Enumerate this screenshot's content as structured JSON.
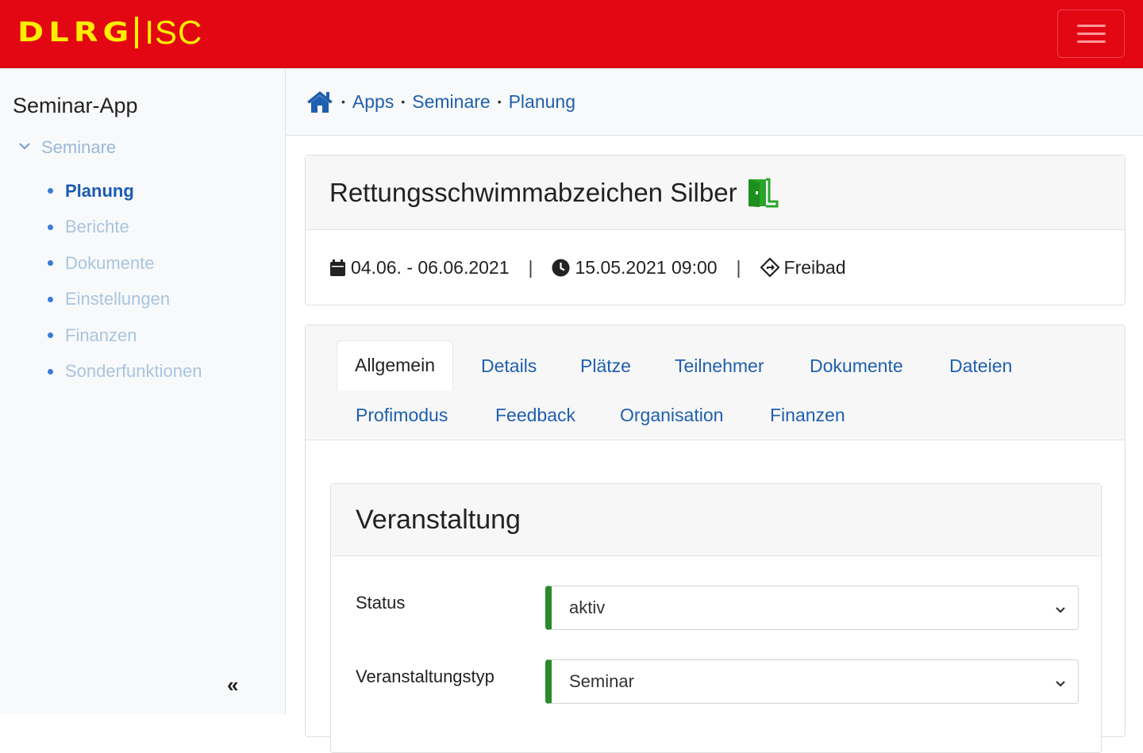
{
  "header": {
    "logo_primary": "DLRG",
    "logo_secondary": "ISC",
    "menu_icon": "hamburger-icon",
    "brand_color": "#e30613",
    "logo_color": "#ffed00"
  },
  "sidebar": {
    "title": "Seminar-App",
    "group": {
      "label": "Seminare",
      "icon": "chevron-down-icon"
    },
    "items": [
      {
        "label": "Planung",
        "active": true
      },
      {
        "label": "Berichte"
      },
      {
        "label": "Dokumente"
      },
      {
        "label": "Einstellungen"
      },
      {
        "label": "Finanzen"
      },
      {
        "label": "Sonderfunktionen"
      }
    ],
    "collapse_label": "«"
  },
  "breadcrumb": {
    "home_icon": "home-icon",
    "sep": "•",
    "items": [
      "Apps",
      "Seminare",
      "Planung"
    ]
  },
  "seminar": {
    "title": "Rettungsschwimmabzeichen Silber",
    "status_icon": "door-open-icon",
    "date_range": "04.06. - 06.06.2021",
    "deadline": "15.05.2021 09:00",
    "location": "Freibad",
    "separator": "|"
  },
  "tabs": {
    "row1": [
      "Allgemein",
      "Details",
      "Plätze",
      "Teilnehmer",
      "Dokumente",
      "Dateien"
    ],
    "row2": [
      "Profimodus",
      "Feedback",
      "Organisation",
      "Finanzen"
    ],
    "active": "Allgemein"
  },
  "veranstaltung": {
    "title": "Veranstaltung",
    "status_label": "Status",
    "status_value": "aktiv",
    "type_label": "Veranstaltungstyp",
    "type_value": "Seminar",
    "valid_color": "#2a8a2a"
  }
}
